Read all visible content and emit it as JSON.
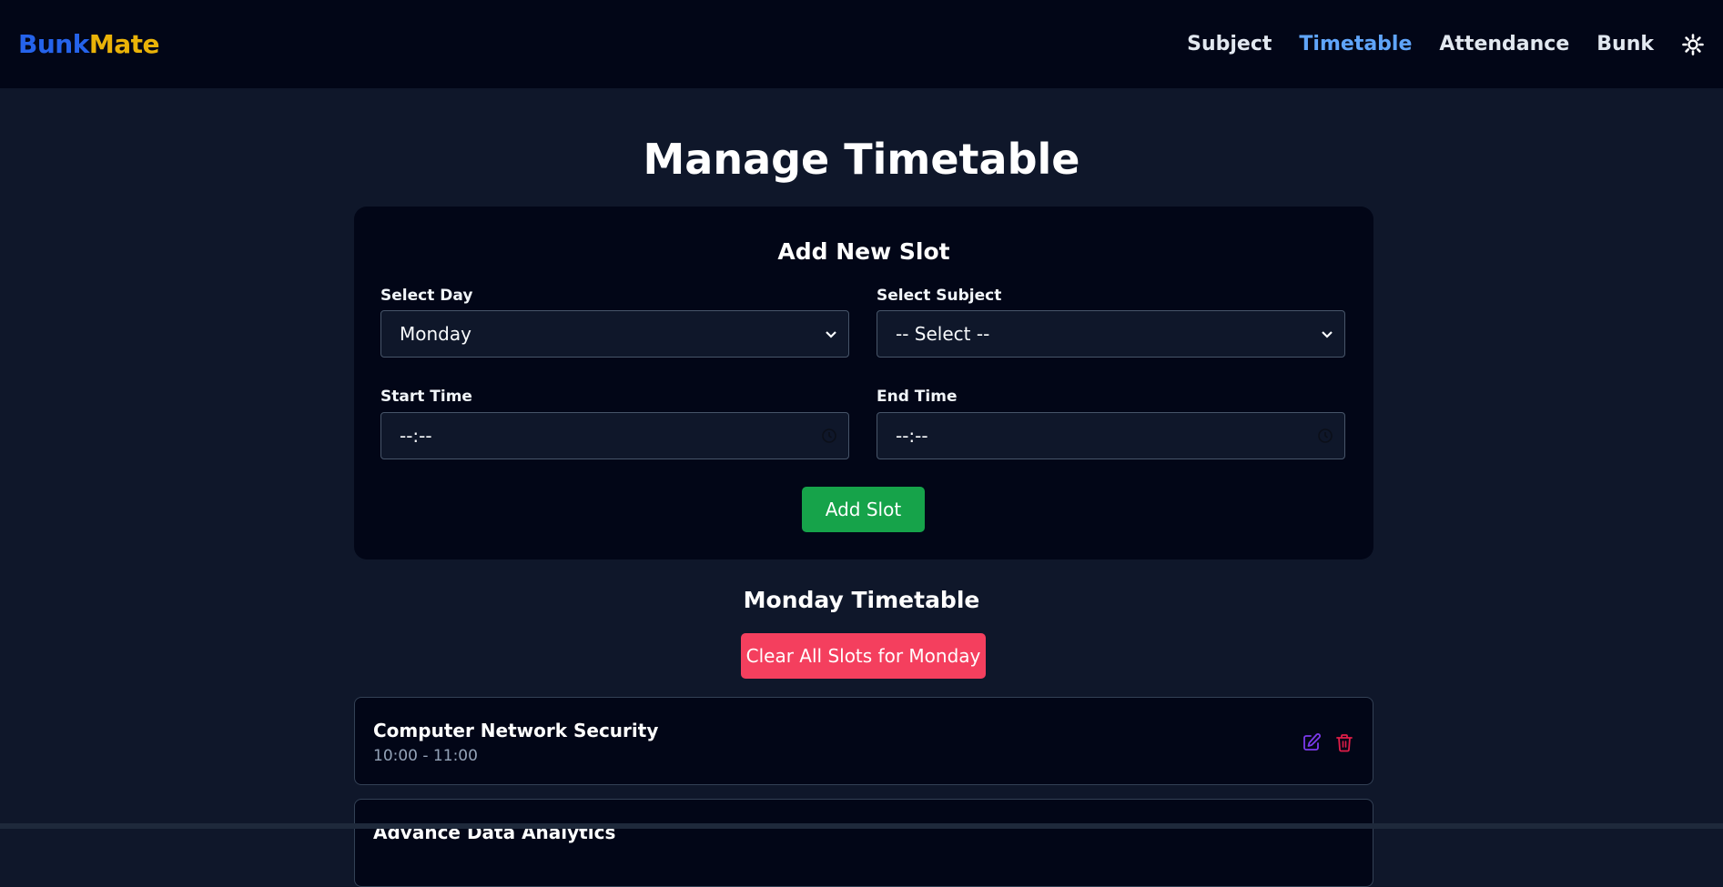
{
  "brand": {
    "part1": "Bunk",
    "part2": "Mate"
  },
  "nav": {
    "items": [
      "Subject",
      "Timetable",
      "Attendance",
      "Bunk"
    ],
    "active": "Timetable"
  },
  "icons": {
    "theme": "sun-icon",
    "select": "chevron-down-icon",
    "time": "clock-icon",
    "edit": "edit-icon",
    "delete": "trash-icon"
  },
  "page": {
    "title": "Manage Timetable"
  },
  "form": {
    "title": "Add New Slot",
    "day_label": "Select Day",
    "day_value": "Monday",
    "subject_label": "Select Subject",
    "subject_value": "-- Select --",
    "start_label": "Start Time",
    "start_value": "--:--",
    "end_label": "End Time",
    "end_value": "--:--",
    "add_button": "Add Slot"
  },
  "timetable": {
    "title": "Monday Timetable",
    "clear_button": "Clear All Slots for Monday",
    "slots": [
      {
        "subject": "Computer Network Security",
        "time": "10:00 - 11:00"
      },
      {
        "subject": "Advance Data Analytics",
        "time": ""
      }
    ]
  },
  "colors": {
    "brand_blue": "#2563eb",
    "brand_yellow": "#eab308",
    "active_nav": "#60a5fa",
    "add_green": "#16a34a",
    "clear_red": "#f43f5e",
    "edit_purple": "#7c3aed",
    "delete_red": "#e11d48"
  }
}
